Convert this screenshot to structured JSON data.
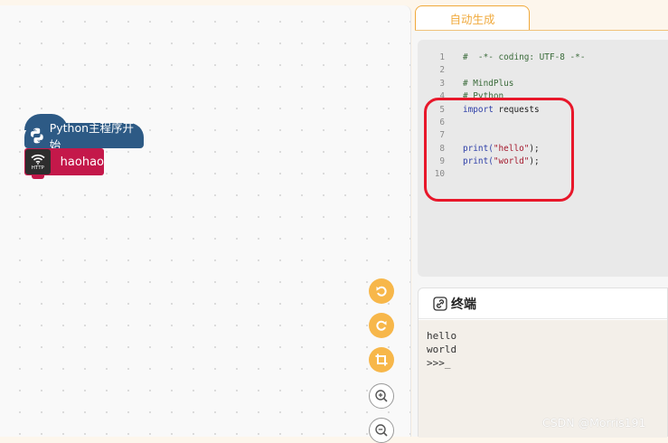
{
  "workspace": {
    "blocks": {
      "main_start_label": "Python主程序开始",
      "http_icon_text": "HTTP",
      "http_block_label": "haohao"
    },
    "controls": [
      "undo-icon",
      "redo-icon",
      "crop-icon",
      "zoom-in-icon",
      "zoom-out-icon"
    ]
  },
  "code_panel": {
    "tab_label": "自动生成",
    "lines": [
      {
        "num": "1",
        "text": "#  -*- coding: UTF-8 -*-"
      },
      {
        "num": "2",
        "text": ""
      },
      {
        "num": "3",
        "text": "# MindPlus"
      },
      {
        "num": "4",
        "text": "# Python"
      },
      {
        "num": "5",
        "kw": "import",
        "rest": " requests"
      },
      {
        "num": "6",
        "text": ""
      },
      {
        "num": "7",
        "text": ""
      },
      {
        "num": "8",
        "fn": "print(",
        "str": "\"hello\"",
        "end": ");"
      },
      {
        "num": "9",
        "fn": "print(",
        "str": "\"world\"",
        "end": ");"
      },
      {
        "num": "10",
        "text": ""
      }
    ]
  },
  "terminal": {
    "title": "终端",
    "output": [
      "hello",
      "world",
      ">>>_"
    ]
  },
  "watermark": "CSDN @Morris191",
  "colors": {
    "accent_orange": "#f0a93b",
    "block_blue": "#2d5a85",
    "block_red": "#c4184a",
    "highlight_red": "#e8172a"
  }
}
